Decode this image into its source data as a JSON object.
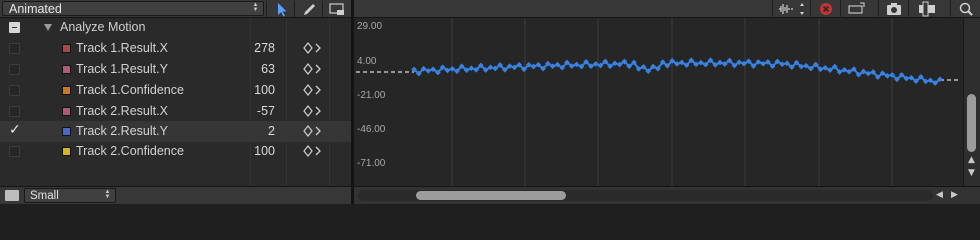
{
  "curve_set": {
    "value": "Animated"
  },
  "tools": {
    "arrow": "select-arrow-icon",
    "pen": "pen-icon",
    "rect": "box-select-icon"
  },
  "group": {
    "name": "Analyze Motion"
  },
  "tracks": [
    {
      "name": "Track 1.Result.X",
      "value": "278",
      "color": "#a84848",
      "checked": false
    },
    {
      "name": "Track 1.Result.Y",
      "value": "63",
      "color": "#b05a78",
      "checked": false
    },
    {
      "name": "Track 1.Confidence",
      "value": "100",
      "color": "#cc7a22",
      "checked": false
    },
    {
      "name": "Track 2.Result.X",
      "value": "-57",
      "color": "#b05a78",
      "checked": false
    },
    {
      "name": "Track 2.Result.Y",
      "value": "2",
      "color": "#4a68c8",
      "checked": true
    },
    {
      "name": "Track 2.Confidence",
      "value": "100",
      "color": "#d2b828",
      "checked": false
    }
  ],
  "bottom": {
    "size_value": "Small"
  },
  "graph": {
    "y_labels": [
      "29.00",
      "4.00",
      "-21.00",
      "-46.00",
      "-71.00"
    ],
    "curve_color": "#3a82e0"
  }
}
